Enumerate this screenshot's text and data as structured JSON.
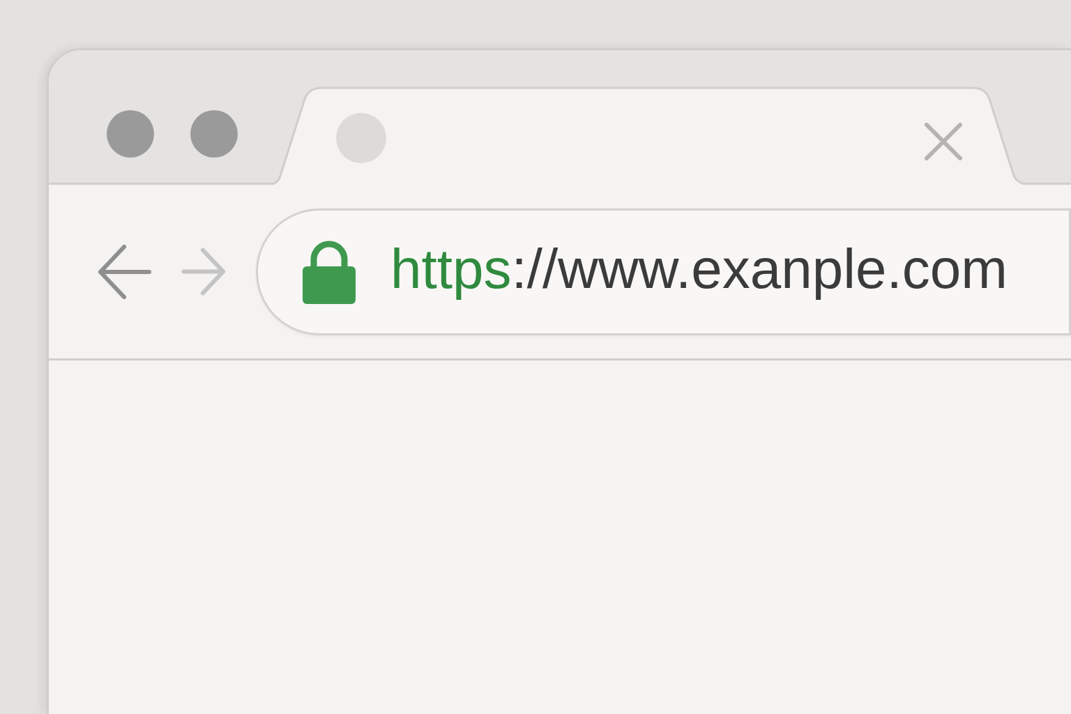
{
  "window_controls": [
    {
      "kind": "dot"
    },
    {
      "kind": "dot"
    }
  ],
  "tab": {
    "selected": true
  },
  "navigation": [
    {
      "kind": "back",
      "disabled": false
    },
    {
      "kind": "forward",
      "disabled": true
    }
  ],
  "address_bar": {
    "secure": true,
    "scheme": "https",
    "rest": "://www.exanple.com"
  }
}
